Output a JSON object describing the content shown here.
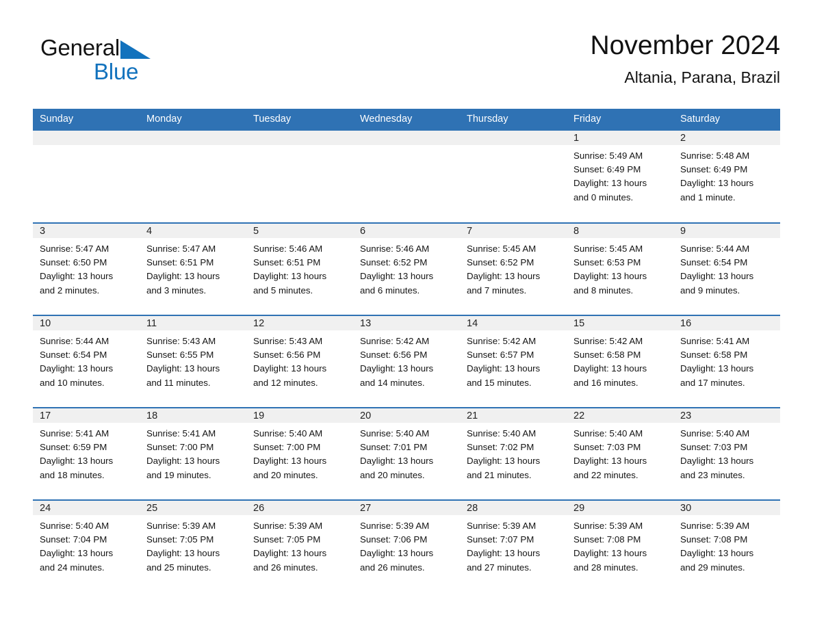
{
  "brand": {
    "name_part1": "General",
    "name_part2": "Blue",
    "flag_icon": "blue-triangle-flag-icon",
    "accent_color": "#1272bd"
  },
  "header": {
    "title": "November 2024",
    "subtitle": "Altania, Parana, Brazil"
  },
  "theme": {
    "header_blue": "#2f72b4",
    "day_band_gray": "#f0f0f0",
    "text_color": "#141414",
    "page_background": "#ffffff"
  },
  "calendar": {
    "month": "November",
    "year": "2024",
    "weekday_headers": [
      "Sunday",
      "Monday",
      "Tuesday",
      "Wednesday",
      "Thursday",
      "Friday",
      "Saturday"
    ],
    "labels": {
      "sunrise_prefix": "Sunrise:",
      "sunset_prefix": "Sunset:",
      "daylight_prefix": "Daylight:"
    },
    "weeks": [
      [
        {
          "day": "",
          "empty": true
        },
        {
          "day": "",
          "empty": true
        },
        {
          "day": "",
          "empty": true
        },
        {
          "day": "",
          "empty": true
        },
        {
          "day": "",
          "empty": true
        },
        {
          "day": "1",
          "sunrise": "Sunrise: 5:49 AM",
          "sunset": "Sunset: 6:49 PM",
          "daylight_line1": "Daylight: 13 hours",
          "daylight_line2": "and 0 minutes."
        },
        {
          "day": "2",
          "sunrise": "Sunrise: 5:48 AM",
          "sunset": "Sunset: 6:49 PM",
          "daylight_line1": "Daylight: 13 hours",
          "daylight_line2": "and 1 minute."
        }
      ],
      [
        {
          "day": "3",
          "sunrise": "Sunrise: 5:47 AM",
          "sunset": "Sunset: 6:50 PM",
          "daylight_line1": "Daylight: 13 hours",
          "daylight_line2": "and 2 minutes."
        },
        {
          "day": "4",
          "sunrise": "Sunrise: 5:47 AM",
          "sunset": "Sunset: 6:51 PM",
          "daylight_line1": "Daylight: 13 hours",
          "daylight_line2": "and 3 minutes."
        },
        {
          "day": "5",
          "sunrise": "Sunrise: 5:46 AM",
          "sunset": "Sunset: 6:51 PM",
          "daylight_line1": "Daylight: 13 hours",
          "daylight_line2": "and 5 minutes."
        },
        {
          "day": "6",
          "sunrise": "Sunrise: 5:46 AM",
          "sunset": "Sunset: 6:52 PM",
          "daylight_line1": "Daylight: 13 hours",
          "daylight_line2": "and 6 minutes."
        },
        {
          "day": "7",
          "sunrise": "Sunrise: 5:45 AM",
          "sunset": "Sunset: 6:52 PM",
          "daylight_line1": "Daylight: 13 hours",
          "daylight_line2": "and 7 minutes."
        },
        {
          "day": "8",
          "sunrise": "Sunrise: 5:45 AM",
          "sunset": "Sunset: 6:53 PM",
          "daylight_line1": "Daylight: 13 hours",
          "daylight_line2": "and 8 minutes."
        },
        {
          "day": "9",
          "sunrise": "Sunrise: 5:44 AM",
          "sunset": "Sunset: 6:54 PM",
          "daylight_line1": "Daylight: 13 hours",
          "daylight_line2": "and 9 minutes."
        }
      ],
      [
        {
          "day": "10",
          "sunrise": "Sunrise: 5:44 AM",
          "sunset": "Sunset: 6:54 PM",
          "daylight_line1": "Daylight: 13 hours",
          "daylight_line2": "and 10 minutes."
        },
        {
          "day": "11",
          "sunrise": "Sunrise: 5:43 AM",
          "sunset": "Sunset: 6:55 PM",
          "daylight_line1": "Daylight: 13 hours",
          "daylight_line2": "and 11 minutes."
        },
        {
          "day": "12",
          "sunrise": "Sunrise: 5:43 AM",
          "sunset": "Sunset: 6:56 PM",
          "daylight_line1": "Daylight: 13 hours",
          "daylight_line2": "and 12 minutes."
        },
        {
          "day": "13",
          "sunrise": "Sunrise: 5:42 AM",
          "sunset": "Sunset: 6:56 PM",
          "daylight_line1": "Daylight: 13 hours",
          "daylight_line2": "and 14 minutes."
        },
        {
          "day": "14",
          "sunrise": "Sunrise: 5:42 AM",
          "sunset": "Sunset: 6:57 PM",
          "daylight_line1": "Daylight: 13 hours",
          "daylight_line2": "and 15 minutes."
        },
        {
          "day": "15",
          "sunrise": "Sunrise: 5:42 AM",
          "sunset": "Sunset: 6:58 PM",
          "daylight_line1": "Daylight: 13 hours",
          "daylight_line2": "and 16 minutes."
        },
        {
          "day": "16",
          "sunrise": "Sunrise: 5:41 AM",
          "sunset": "Sunset: 6:58 PM",
          "daylight_line1": "Daylight: 13 hours",
          "daylight_line2": "and 17 minutes."
        }
      ],
      [
        {
          "day": "17",
          "sunrise": "Sunrise: 5:41 AM",
          "sunset": "Sunset: 6:59 PM",
          "daylight_line1": "Daylight: 13 hours",
          "daylight_line2": "and 18 minutes."
        },
        {
          "day": "18",
          "sunrise": "Sunrise: 5:41 AM",
          "sunset": "Sunset: 7:00 PM",
          "daylight_line1": "Daylight: 13 hours",
          "daylight_line2": "and 19 minutes."
        },
        {
          "day": "19",
          "sunrise": "Sunrise: 5:40 AM",
          "sunset": "Sunset: 7:00 PM",
          "daylight_line1": "Daylight: 13 hours",
          "daylight_line2": "and 20 minutes."
        },
        {
          "day": "20",
          "sunrise": "Sunrise: 5:40 AM",
          "sunset": "Sunset: 7:01 PM",
          "daylight_line1": "Daylight: 13 hours",
          "daylight_line2": "and 20 minutes."
        },
        {
          "day": "21",
          "sunrise": "Sunrise: 5:40 AM",
          "sunset": "Sunset: 7:02 PM",
          "daylight_line1": "Daylight: 13 hours",
          "daylight_line2": "and 21 minutes."
        },
        {
          "day": "22",
          "sunrise": "Sunrise: 5:40 AM",
          "sunset": "Sunset: 7:03 PM",
          "daylight_line1": "Daylight: 13 hours",
          "daylight_line2": "and 22 minutes."
        },
        {
          "day": "23",
          "sunrise": "Sunrise: 5:40 AM",
          "sunset": "Sunset: 7:03 PM",
          "daylight_line1": "Daylight: 13 hours",
          "daylight_line2": "and 23 minutes."
        }
      ],
      [
        {
          "day": "24",
          "sunrise": "Sunrise: 5:40 AM",
          "sunset": "Sunset: 7:04 PM",
          "daylight_line1": "Daylight: 13 hours",
          "daylight_line2": "and 24 minutes."
        },
        {
          "day": "25",
          "sunrise": "Sunrise: 5:39 AM",
          "sunset": "Sunset: 7:05 PM",
          "daylight_line1": "Daylight: 13 hours",
          "daylight_line2": "and 25 minutes."
        },
        {
          "day": "26",
          "sunrise": "Sunrise: 5:39 AM",
          "sunset": "Sunset: 7:05 PM",
          "daylight_line1": "Daylight: 13 hours",
          "daylight_line2": "and 26 minutes."
        },
        {
          "day": "27",
          "sunrise": "Sunrise: 5:39 AM",
          "sunset": "Sunset: 7:06 PM",
          "daylight_line1": "Daylight: 13 hours",
          "daylight_line2": "and 26 minutes."
        },
        {
          "day": "28",
          "sunrise": "Sunrise: 5:39 AM",
          "sunset": "Sunset: 7:07 PM",
          "daylight_line1": "Daylight: 13 hours",
          "daylight_line2": "and 27 minutes."
        },
        {
          "day": "29",
          "sunrise": "Sunrise: 5:39 AM",
          "sunset": "Sunset: 7:08 PM",
          "daylight_line1": "Daylight: 13 hours",
          "daylight_line2": "and 28 minutes."
        },
        {
          "day": "30",
          "sunrise": "Sunrise: 5:39 AM",
          "sunset": "Sunset: 7:08 PM",
          "daylight_line1": "Daylight: 13 hours",
          "daylight_line2": "and 29 minutes."
        }
      ]
    ]
  }
}
